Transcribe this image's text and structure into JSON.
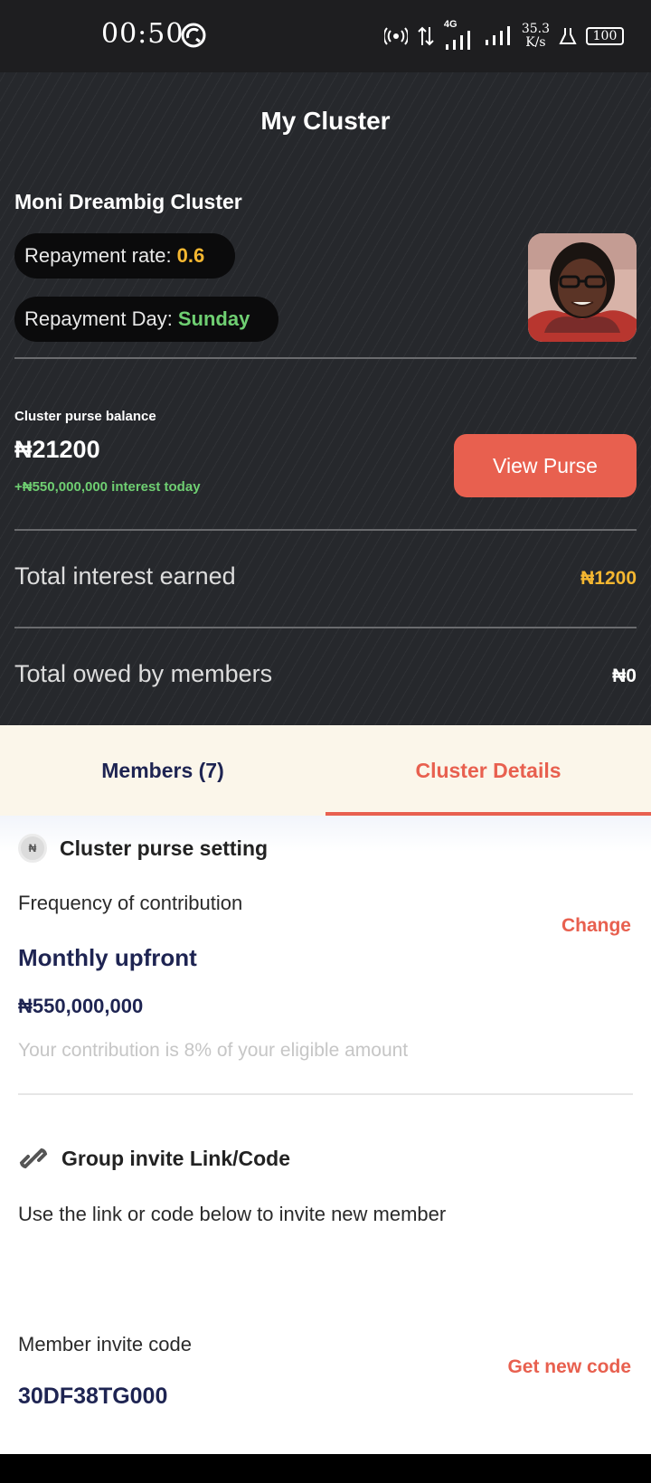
{
  "status_bar": {
    "time": "00:50",
    "network": "4G",
    "speed_value": "35.3",
    "speed_unit": "K/s",
    "battery": "100"
  },
  "header": {
    "title": "My Cluster"
  },
  "cluster": {
    "name": "Moni Dreambig Cluster",
    "repayment_rate_label": "Repayment rate:",
    "repayment_rate_value": "0.6",
    "repayment_day_label": "Repayment Day:",
    "repayment_day_value": "Sunday"
  },
  "purse": {
    "label": "Cluster purse balance",
    "amount": "₦21200",
    "interest_today": "+₦550,000,000 interest today",
    "view_button": "View Purse"
  },
  "totals": {
    "interest_label": "Total interest earned",
    "interest_value": "₦1200",
    "owed_label": "Total owed by members",
    "owed_value": "₦0"
  },
  "tabs": {
    "members": "Members (7)",
    "details": "Cluster Details",
    "active": "details"
  },
  "purse_setting": {
    "heading": "Cluster purse setting",
    "frequency_label": "Frequency of contribution",
    "change_link": "Change",
    "frequency_value": "Monthly upfront",
    "amount": "₦550,000,000",
    "note": "Your contribution is 8% of your eligible amount"
  },
  "invite": {
    "heading": "Group invite Link/Code",
    "description": "Use the link or code below to invite new member",
    "code_label": "Member invite code",
    "code": "30DF38TG000",
    "new_code_link": "Get new code"
  },
  "colors": {
    "accent": "#e8604f",
    "gold": "#f5b731",
    "green": "#6fcf72",
    "navy": "#1e2452",
    "hero_bg": "#26282c",
    "tab_bg": "#fbf6ea"
  },
  "icons": [
    "sync-icon",
    "hotspot-icon",
    "data-arrows-icon",
    "signal-icon",
    "flask-icon",
    "battery-icon",
    "naira-coin-icon",
    "link-icon"
  ]
}
